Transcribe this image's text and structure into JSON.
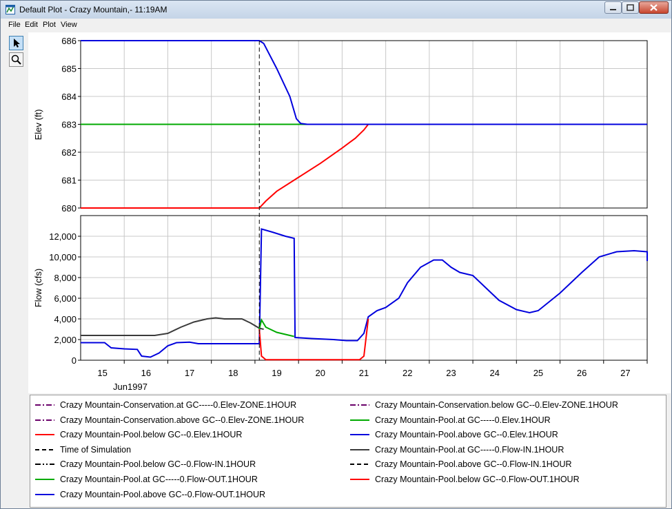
{
  "window": {
    "title": "Default Plot - Crazy Mountain,- 11:19AM",
    "menu": [
      "File",
      "Edit",
      "Plot",
      "View"
    ]
  },
  "toolbar": [
    {
      "icon": "pointer-arrow-icon",
      "active": true
    },
    {
      "icon": "zoom-magnifier-icon",
      "active": false
    }
  ],
  "colors": {
    "red": "#ff0000",
    "blue": "#0000dd",
    "green": "#00aa00",
    "black": "#000000",
    "gray": "#3a3a3a",
    "purple": "#6a006a"
  },
  "chart_data": [
    {
      "type": "line",
      "ylabel": "Elev (ft)",
      "ylim": [
        680,
        686
      ],
      "y_ticks": [
        "680",
        "681",
        "682",
        "683",
        "684",
        "685",
        "686"
      ],
      "xlim": [
        14.5,
        27.5
      ],
      "grid": true,
      "time_of_simulation_x": 18.6,
      "series": [
        {
          "name": "Crazy Mountain-Conservation.at GC-----0.Elev-ZONE.1HOUR",
          "color": "#6a006a",
          "style": "dashdot",
          "points": [
            [
              14.5,
              683
            ],
            [
              27.5,
              683
            ]
          ]
        },
        {
          "name": "Crazy Mountain-Pool.at GC-----0.Elev.1HOUR",
          "color": "#00aa00",
          "style": "solid",
          "points": [
            [
              14.5,
              683
            ],
            [
              27.5,
              683
            ]
          ]
        },
        {
          "name": "Crazy Mountain-Pool.below GC--0.Elev.1HOUR",
          "color": "#ff0000",
          "style": "solid",
          "points": [
            [
              14.5,
              680
            ],
            [
              18.6,
              680
            ],
            [
              18.75,
              680.25
            ],
            [
              19.0,
              680.6
            ],
            [
              19.5,
              681.1
            ],
            [
              20.0,
              681.6
            ],
            [
              20.5,
              682.15
            ],
            [
              20.8,
              682.5
            ],
            [
              21.0,
              682.8
            ],
            [
              21.1,
              683
            ],
            [
              27.5,
              683
            ]
          ]
        },
        {
          "name": "Crazy Mountain-Pool.above GC--0.Elev.1HOUR",
          "color": "#0000dd",
          "style": "solid",
          "points": [
            [
              14.5,
              686
            ],
            [
              18.6,
              686
            ],
            [
              18.7,
              685.9
            ],
            [
              19.0,
              685.0
            ],
            [
              19.3,
              684.0
            ],
            [
              19.45,
              683.2
            ],
            [
              19.55,
              683.03
            ],
            [
              19.7,
              683
            ],
            [
              27.5,
              683
            ]
          ]
        }
      ]
    },
    {
      "type": "line",
      "ylabel": "Flow (cfs)",
      "ylim": [
        0,
        14000
      ],
      "y_ticks": [
        "0",
        "2,000",
        "4,000",
        "6,000",
        "8,000",
        "10,000",
        "12,000"
      ],
      "xlim": [
        14.5,
        27.5
      ],
      "x_ticks": [
        "15",
        "16",
        "17",
        "18",
        "19",
        "20",
        "21",
        "22",
        "23",
        "24",
        "25",
        "26",
        "27"
      ],
      "x_sublabel": "Jun1997",
      "grid": true,
      "time_of_simulation_x": 18.6,
      "series": [
        {
          "name": "Crazy Mountain-Pool.at GC-----0.Flow-IN.1HOUR",
          "color": "#3a3a3a",
          "style": "solid",
          "points": [
            [
              14.5,
              2400
            ],
            [
              16.2,
              2400
            ],
            [
              16.5,
              2600
            ],
            [
              16.8,
              3200
            ],
            [
              17.1,
              3700
            ],
            [
              17.4,
              4000
            ],
            [
              17.6,
              4100
            ],
            [
              17.8,
              4000
            ],
            [
              18.2,
              4000
            ],
            [
              18.4,
              3600
            ],
            [
              18.6,
              3100
            ],
            [
              18.7,
              3000
            ]
          ]
        },
        {
          "name": "Crazy Mountain-Pool.above GC--0.Flow-OUT.1HOUR",
          "color": "#0000dd",
          "style": "solid",
          "points": [
            [
              14.5,
              1700
            ],
            [
              15.05,
              1700
            ],
            [
              15.2,
              1200
            ],
            [
              15.5,
              1100
            ],
            [
              15.8,
              1050
            ],
            [
              15.9,
              400
            ],
            [
              16.1,
              300
            ],
            [
              16.3,
              700
            ],
            [
              16.5,
              1400
            ],
            [
              16.7,
              1700
            ],
            [
              17.0,
              1750
            ],
            [
              17.2,
              1600
            ],
            [
              18.5,
              1600
            ],
            [
              18.6,
              1600
            ],
            [
              18.65,
              12700
            ],
            [
              18.9,
              12400
            ],
            [
              19.2,
              12000
            ],
            [
              19.4,
              11800
            ],
            [
              19.42,
              2200
            ],
            [
              19.8,
              2100
            ],
            [
              20.3,
              2000
            ],
            [
              20.6,
              1900
            ],
            [
              20.85,
              1900
            ],
            [
              21.0,
              2600
            ],
            [
              21.1,
              4200
            ],
            [
              21.3,
              4800
            ],
            [
              21.5,
              5100
            ],
            [
              21.8,
              6000
            ],
            [
              22.0,
              7500
            ],
            [
              22.3,
              9000
            ],
            [
              22.6,
              9700
            ],
            [
              22.8,
              9700
            ],
            [
              23.0,
              9000
            ],
            [
              23.2,
              8500
            ],
            [
              23.5,
              8200
            ],
            [
              23.8,
              7000
            ],
            [
              24.1,
              5800
            ],
            [
              24.5,
              4900
            ],
            [
              24.8,
              4600
            ],
            [
              25.0,
              4800
            ],
            [
              25.5,
              6500
            ],
            [
              26.0,
              8500
            ],
            [
              26.4,
              10000
            ],
            [
              26.8,
              10500
            ],
            [
              27.2,
              10600
            ],
            [
              27.6,
              10500
            ],
            [
              28.0,
              10400
            ],
            [
              28.3,
              10300
            ],
            [
              28.8,
              10100
            ],
            [
              29.2,
              9800
            ],
            [
              29.4,
              9600
            ]
          ]
        },
        {
          "name": "Crazy Mountain-Pool.at GC-----0.Flow-OUT.1HOUR",
          "color": "#00aa00",
          "style": "solid",
          "points": [
            [
              18.6,
              3000
            ],
            [
              18.65,
              3900
            ],
            [
              18.75,
              3200
            ],
            [
              19.0,
              2700
            ],
            [
              19.4,
              2300
            ]
          ]
        },
        {
          "name": "Crazy Mountain-Pool.below GC--0.Flow-OUT.1HOUR",
          "color": "#ff0000",
          "style": "solid",
          "points": [
            [
              18.6,
              3000
            ],
            [
              18.65,
              400
            ],
            [
              18.75,
              50
            ],
            [
              19.0,
              50
            ],
            [
              20.9,
              50
            ],
            [
              21.0,
              400
            ],
            [
              21.1,
              4000
            ]
          ]
        }
      ]
    }
  ],
  "legend": [
    {
      "label": "Crazy Mountain-Conservation.at GC-----0.Elev-ZONE.1HOUR",
      "color": "#6a006a",
      "style": "dashdot"
    },
    {
      "label": "Crazy Mountain-Conservation.below GC--0.Elev-ZONE.1HOUR",
      "color": "#6a006a",
      "style": "dashdot"
    },
    {
      "label": "Crazy Mountain-Conservation.above GC--0.Elev-ZONE.1HOUR",
      "color": "#6a006a",
      "style": "dashdot"
    },
    {
      "label": "Crazy Mountain-Pool.at GC-----0.Elev.1HOUR",
      "color": "#00aa00",
      "style": "solid"
    },
    {
      "label": "Crazy Mountain-Pool.below GC--0.Elev.1HOUR",
      "color": "#ff0000",
      "style": "solid"
    },
    {
      "label": "Crazy Mountain-Pool.above GC--0.Elev.1HOUR",
      "color": "#0000dd",
      "style": "solid"
    },
    {
      "label": "Time of Simulation",
      "color": "#000000",
      "style": "dashed"
    },
    {
      "label": "Crazy Mountain-Pool.at GC-----0.Flow-IN.1HOUR",
      "color": "#3a3a3a",
      "style": "solid"
    },
    {
      "label": "Crazy Mountain-Pool.below GC--0.Flow-IN.1HOUR",
      "color": "#000000",
      "style": "dashdotdot"
    },
    {
      "label": "Crazy Mountain-Pool.above GC--0.Flow-IN.1HOUR",
      "color": "#000000",
      "style": "dashed"
    },
    {
      "label": "Crazy Mountain-Pool.at GC-----0.Flow-OUT.1HOUR",
      "color": "#00aa00",
      "style": "solid"
    },
    {
      "label": "Crazy Mountain-Pool.below GC--0.Flow-OUT.1HOUR",
      "color": "#ff0000",
      "style": "solid"
    },
    {
      "label": "Crazy Mountain-Pool.above GC--0.Flow-OUT.1HOUR",
      "color": "#0000dd",
      "style": "solid"
    }
  ]
}
